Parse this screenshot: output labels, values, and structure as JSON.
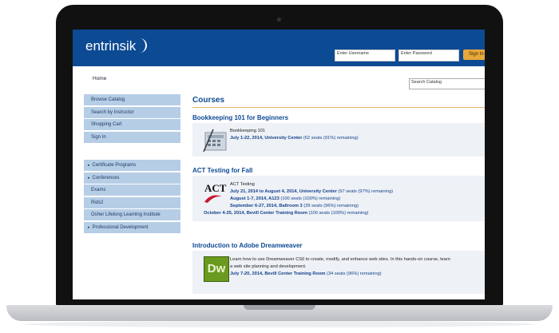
{
  "app": {
    "logo_text": "entrinsik"
  },
  "header": {
    "username_placeholder": "Enter Username",
    "password_placeholder": "Enter Password",
    "signin_label": "Sign In"
  },
  "nav": {
    "home_label": "Home",
    "catalog_search_placeholder": "Search Catalog"
  },
  "sidebar": {
    "top_items": [
      {
        "label": "Browse Catalog",
        "arrow": ""
      },
      {
        "label": "Search by Instructor",
        "arrow": ""
      },
      {
        "label": "Shopping Cart",
        "arrow": ""
      },
      {
        "label": "Sign In",
        "arrow": ""
      }
    ],
    "bottom_items": [
      {
        "label": "Certificate Programs",
        "arrow": "▸"
      },
      {
        "label": "Conferences",
        "arrow": "▸"
      },
      {
        "label": "Exams",
        "arrow": ""
      },
      {
        "label": "Rids2",
        "arrow": ""
      },
      {
        "label": "Osher Lifelong Learning Institute",
        "arrow": ""
      },
      {
        "label": "Professional Development",
        "arrow": "▸"
      }
    ]
  },
  "main": {
    "title": "Courses",
    "courses": [
      {
        "title": "Bookkeeping 101 for Beginners",
        "thumb_icon": "calculator-icon",
        "lines": [
          {
            "text": "Bookkeeping 101",
            "link": ""
          },
          {
            "text": "",
            "link": "July 1-22, 2014, University Center",
            "tail": " (62 seats (91%) remaining)"
          }
        ]
      },
      {
        "title": "ACT Testing for Fall",
        "thumb_icon": "act-logo-icon",
        "thumb_text": "ACT",
        "lines": [
          {
            "text": "ACT Testing",
            "link": ""
          },
          {
            "text": "",
            "link": "July 21, 2014 to August 4, 2014, University Center",
            "tail": " (97 seats (97%) remaining)"
          },
          {
            "text": "",
            "link": "August 1-7, 2014, A123",
            "tail": " (100 seats (100%) remaining)"
          },
          {
            "text": "",
            "link": "September 6-27, 2014, Ballroom 3",
            "tail": " (39 seats (96%) remaining)"
          },
          {
            "text": "",
            "link": "October 4-25, 2014, Bevill Center Training Room",
            "tail": " (100 seats (100%) remaining)"
          }
        ]
      },
      {
        "title": "Introduction to Adobe Dreamweaver",
        "thumb_icon": "dreamweaver-logo-icon",
        "thumb_text": "Dw",
        "lines": [
          {
            "text": "Learn how to use Dreamweaver CS6 to create, modify, and enhance web sites. In this hands-on course, learn",
            "link": ""
          },
          {
            "text": "a web site planning and development.",
            "link": ""
          },
          {
            "text": "",
            "link": "July 7-20, 2014, Bevill Center Training Room",
            "tail": " (34 seats (96%) remaining)"
          }
        ]
      }
    ]
  },
  "colors": {
    "header": "#0d4a94",
    "sidebar": "#b6cde6",
    "accent": "#e9a83a",
    "link": "#12418c"
  }
}
